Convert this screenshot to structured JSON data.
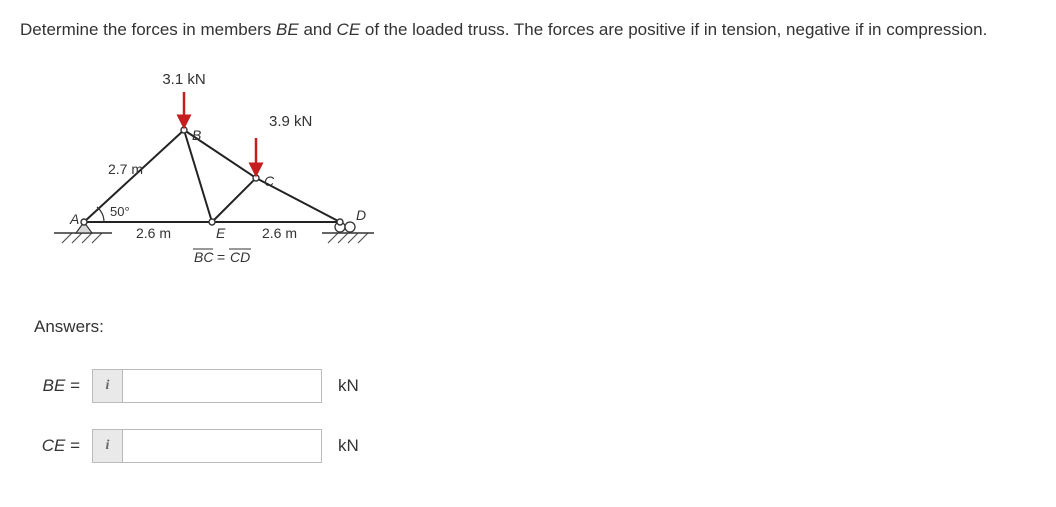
{
  "question": {
    "prefix": "Determine the forces in members ",
    "m1": "BE",
    "mid1": " and ",
    "m2": "CE",
    "suffix": " of the loaded truss. The forces are positive if in tension, negative if in compression."
  },
  "diagram": {
    "load_B": "3.1 kN",
    "load_C": "3.9 kN",
    "len_AB": "2.7 m",
    "len_AE": "2.6 m",
    "len_ED": "2.6 m",
    "angle_A": "50°",
    "pt_A": "A",
    "pt_B": "B",
    "pt_C": "C",
    "pt_D": "D",
    "pt_E": "E",
    "note": "BC = CD",
    "note_overline_BC": "BC",
    "note_overline_CD": "CD"
  },
  "answers_heading": "Answers:",
  "rows": [
    {
      "label": "BE",
      "eq": "=",
      "info": "i",
      "value": "",
      "unit": "kN"
    },
    {
      "label": "CE",
      "eq": "=",
      "info": "i",
      "value": "",
      "unit": "kN"
    }
  ]
}
